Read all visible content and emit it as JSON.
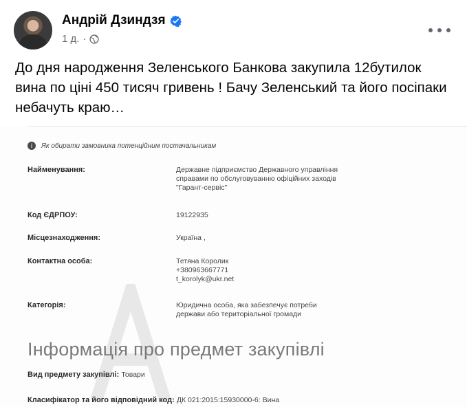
{
  "post": {
    "author": "Андрій Дзиндзя",
    "time": "1 д.",
    "separator": "·",
    "text": "До дня народження Зеленського Банкова закупила 12бутилок вина по ціні 450 тисяч гривень ! Бачу Зеленський та його посіпаки небачуть краю…"
  },
  "embed": {
    "hint": "Як обирати замовника потенційним постачальникам",
    "fields": {
      "name": {
        "label": "Найменування:",
        "value": [
          "Державне підприємство Державного управління",
          "справами по обслуговуванню офіційних заходів",
          "\"Гарант-сервіс\""
        ]
      },
      "code": {
        "label": "Код ЄДРПОУ:",
        "value": "19122935"
      },
      "location": {
        "label": "Місцезнаходження:",
        "value": "Україна ,"
      },
      "contact": {
        "label": "Контактна особа:",
        "value": [
          "Тетяна Королик",
          "+380963667771",
          "t_korolyk@ukr.net"
        ]
      },
      "category": {
        "label": "Категорія:",
        "value": [
          "Юридична особа, яка забезпечує потреби",
          "держави або територіальної громади"
        ]
      }
    },
    "section_title": "Інформація про предмет закупівлі",
    "subject_type": {
      "label": "Вид предмету закупівлі:",
      "value": "Товари"
    },
    "classifier": {
      "label": "Класифікатор та його відповідний код:",
      "value": "ДК 021:2015:15930000-6: Вина"
    }
  },
  "icons": {
    "verified": "verified-badge-icon",
    "globe": "globe-icon",
    "more": "more-options-icon",
    "info": "info-icon"
  },
  "colors": {
    "verified": "#1877f2",
    "meta": "#65676b"
  }
}
